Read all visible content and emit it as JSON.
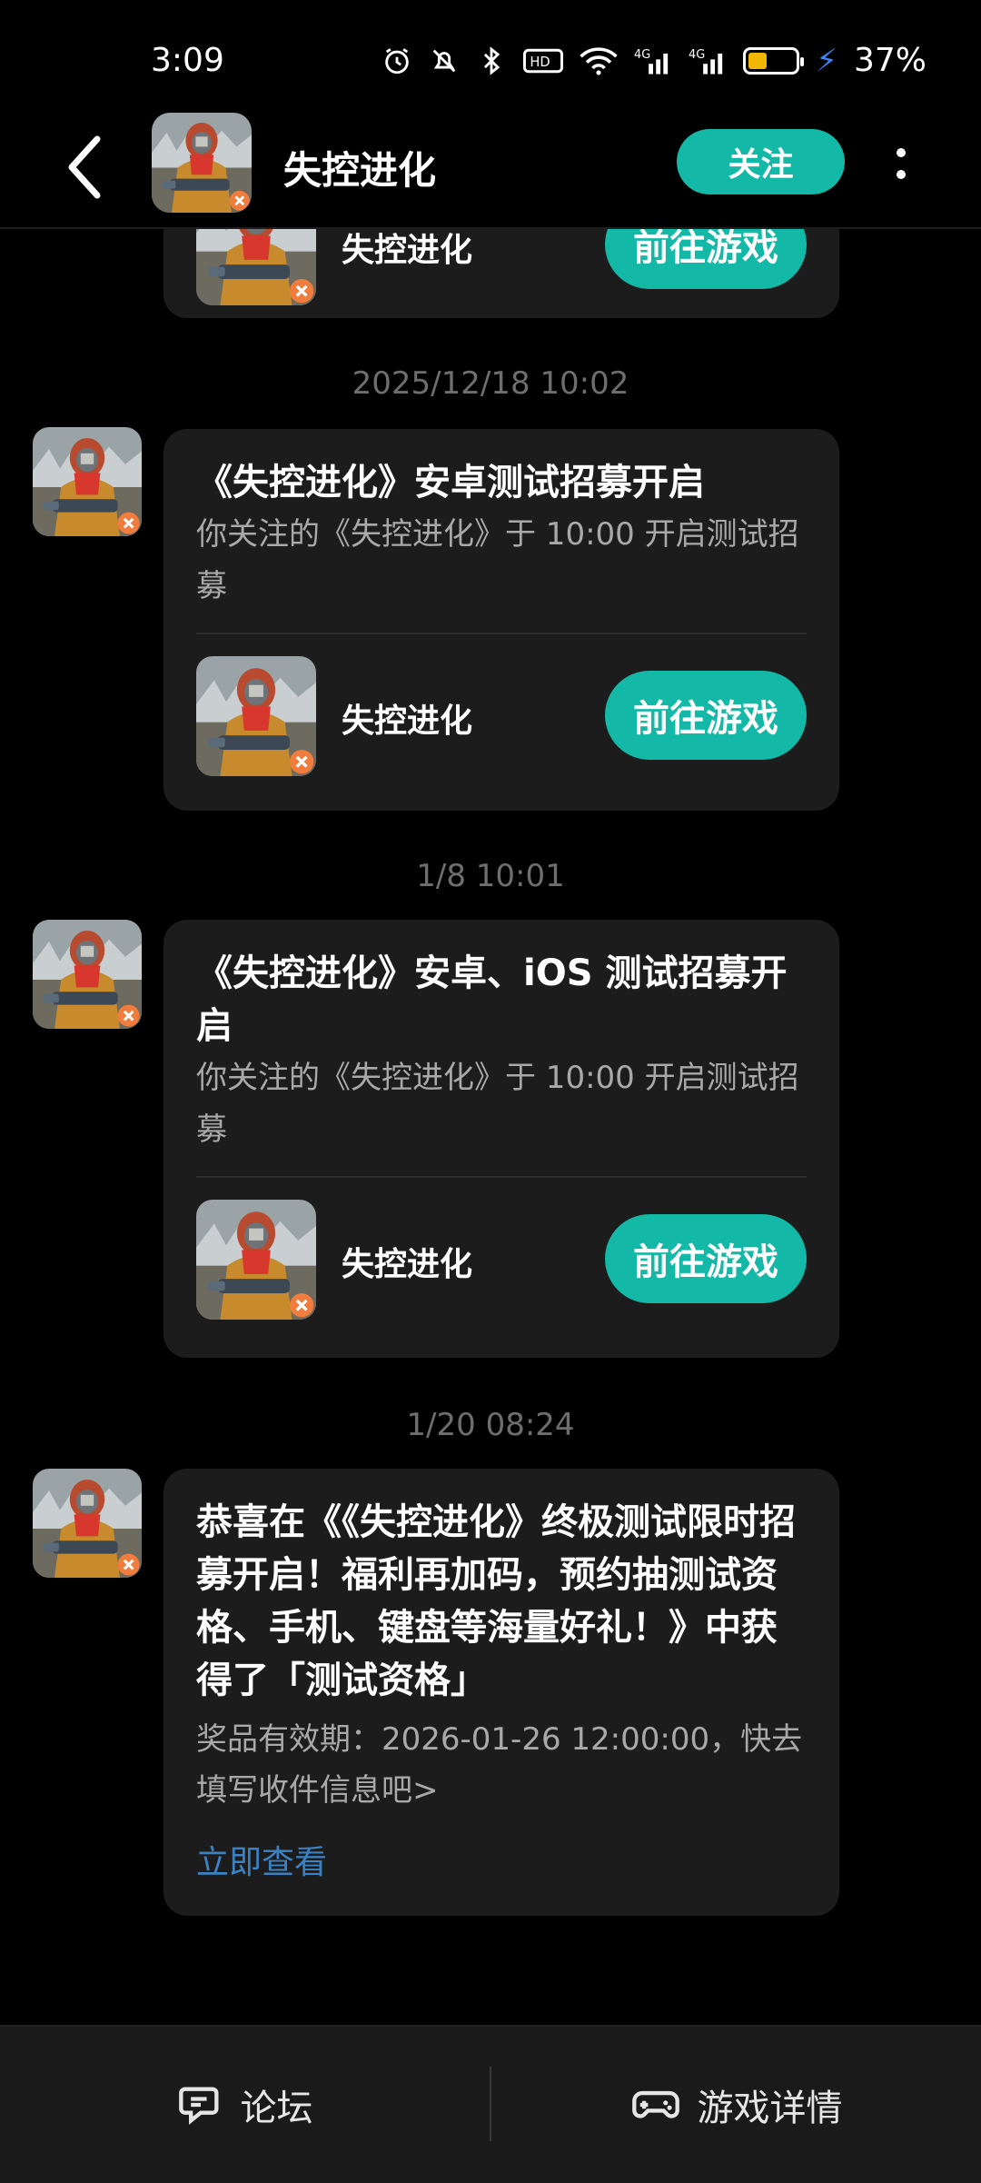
{
  "status_bar": {
    "time": "3:09",
    "battery_percent": "37%",
    "battery_level": 0.37,
    "icons": [
      "alarm-icon",
      "mute-icon",
      "bluetooth-icon",
      "hd-icon",
      "wifi-icon",
      "signal-4g-icon",
      "signal-4g-icon",
      "battery-icon",
      "charging-icon"
    ]
  },
  "header": {
    "title": "失控进化",
    "follow_label": "关注"
  },
  "messages": [
    {
      "game_name": "失控进化",
      "go_label": "前往游戏"
    },
    {
      "timestamp": "2025/12/18  10:02",
      "title": "《失控进化》安卓测试招募开启",
      "desc": "你关注的《失控进化》于 10:00 开启测试招募",
      "game_name": "失控进化",
      "go_label": "前往游戏"
    },
    {
      "timestamp": "1/8  10:01",
      "title": "《失控进化》安卓、iOS 测试招募开启",
      "desc": "你关注的《失控进化》于 10:00 开启测试招募",
      "game_name": "失控进化",
      "go_label": "前往游戏"
    },
    {
      "timestamp": "1/20  08:24",
      "title": "恭喜在《《失控进化》终极测试限时招募开启！福利再加码，预约抽测试资格、手机、键盘等海量好礼！》中获得了「测试资格」",
      "desc": "奖品有效期：2026-01-26 12:00:00，快去填写收件信息吧>",
      "link_label": "立即查看"
    }
  ],
  "bottom_bar": {
    "forum_label": "论坛",
    "details_label": "游戏详情"
  },
  "colors": {
    "accent": "#14b8a6",
    "link": "#3b82c4",
    "card_bg": "#1c1c1c"
  }
}
